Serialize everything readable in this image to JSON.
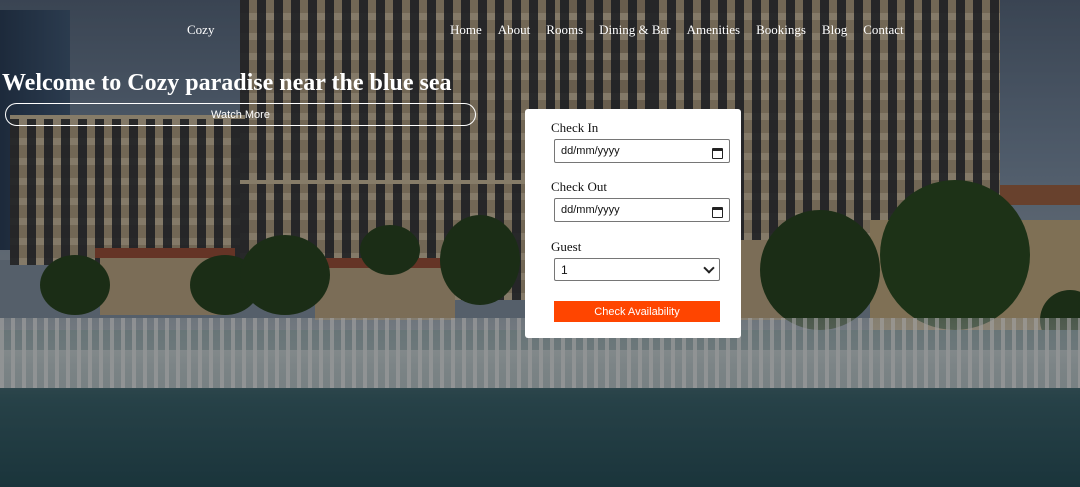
{
  "brand": "Cozy",
  "nav": [
    "Home",
    "About",
    "Rooms",
    "Dining & Bar",
    "Amenities",
    "Bookings",
    "Blog",
    "Contact"
  ],
  "hero": {
    "title": "Welcome to Cozy paradise near the blue sea",
    "button": "Watch More"
  },
  "booking": {
    "check_in_label": "Check In",
    "check_in_value": "dd/mm/yyyy",
    "check_out_label": "Check Out",
    "check_out_value": "dd/mm/yyyy",
    "guest_label": "Guest",
    "guest_value": "1",
    "submit": "Check Availability"
  },
  "colors": {
    "accent": "#ff4500",
    "card": "#ffffff",
    "text_light": "#ffffff"
  },
  "icons": {
    "date": "calendar-icon",
    "select": "chevron-down-icon"
  }
}
